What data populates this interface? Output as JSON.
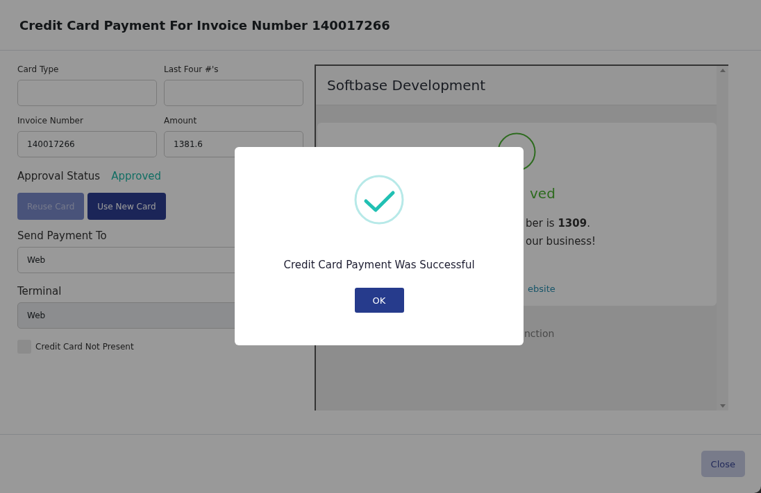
{
  "dialog": {
    "title": "Credit Card Payment For Invoice Number 140017266"
  },
  "fields": [
    {
      "label": "Card Type"
    },
    {
      "label": "Last Four #'s"
    },
    {
      "label": "Invoice Number",
      "value": "140017266"
    },
    {
      "label": "Amount",
      "value": "1381.6"
    }
  ],
  "approval": {
    "label": "Approval Status",
    "value": "Approved"
  },
  "card_buttons": [
    {
      "label": "Reuse Card",
      "disabled": true
    },
    {
      "label": "Use New Card",
      "disabled": false
    }
  ],
  "selects": [
    {
      "label": "Send Payment To",
      "value": "Web",
      "disabled": false
    },
    {
      "label": "Terminal",
      "value": "Web",
      "disabled": true
    }
  ],
  "checkbox": {
    "label": "Credit Card Not Present",
    "checked": false
  },
  "receipt": {
    "merchant": "Softbase Development",
    "status": "ved",
    "lines": [
      "ber is **1309**.",
      "our business!"
    ],
    "link": "ebsite",
    "footer": "nction"
  },
  "footer_buttons": [
    {
      "label": "Close"
    }
  ],
  "popup": {
    "message": "Credit Card Payment Was Successful",
    "button": "OK"
  }
}
